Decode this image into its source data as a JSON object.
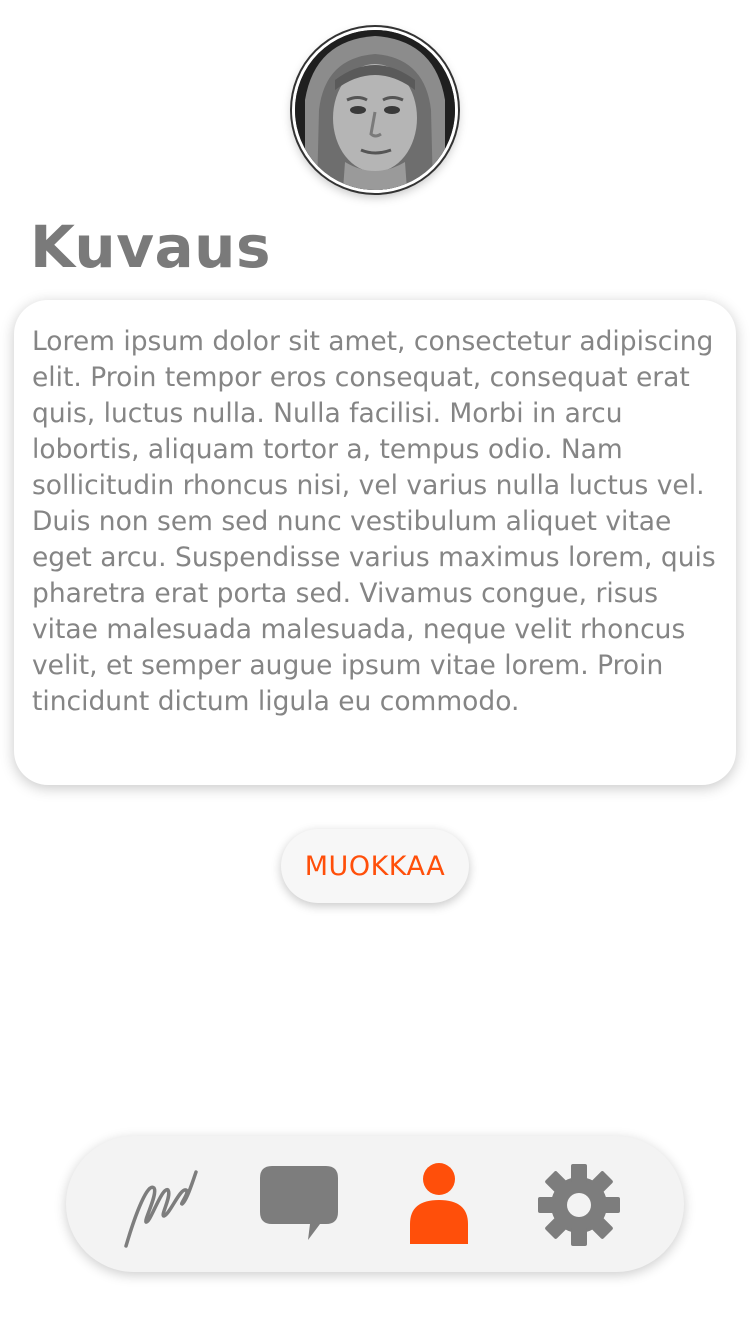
{
  "profile": {
    "avatar_icon": "user-portrait-photo"
  },
  "description": {
    "title": "Kuvaus",
    "text": "Lorem ipsum dolor sit amet, consectetur adipiscing elit. Proin tempor eros consequat, consequat erat quis, luctus nulla. Nulla facilisi. Morbi in arcu lobortis, aliquam tortor a, tempus odio. Nam sollicitudin rhoncus nisi, vel varius nulla luctus vel. Duis non sem sed nunc vestibulum aliquet vitae eget arcu. Suspendisse varius maximus lorem, quis pharetra erat porta sed. Vivamus congue, risus vitae malesuada malesuada, neque velit rhoncus velit, et semper augue ipsum vitae lorem. Proin tincidunt dictum ligula eu commodo."
  },
  "edit_button": {
    "label": "MUOKKAA"
  },
  "tab_bar": {
    "tabs": [
      {
        "icon": "signature-icon",
        "active": false
      },
      {
        "icon": "chat-bubble-icon",
        "active": false
      },
      {
        "icon": "person-icon",
        "active": true
      },
      {
        "icon": "gear-icon",
        "active": false
      }
    ]
  },
  "colors": {
    "accent": "#ff4f0a",
    "icon_inactive": "#7d7d7d",
    "text": "#858585",
    "title": "#7a7a7a",
    "tab_bar_background": "#f3f3f3"
  }
}
